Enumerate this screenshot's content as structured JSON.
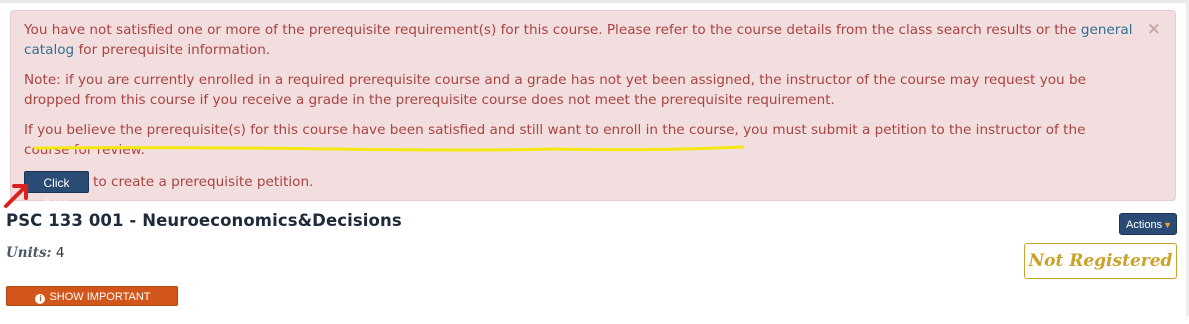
{
  "alert": {
    "p1_before": "You have not satisfied one or more of the prerequisite requirement(s) for this course. Please refer to the course details from the class search results or the ",
    "p1_link": "general catalog",
    "p1_after": " for prerequisite information.",
    "p2": "Note: if you are currently enrolled in a required prerequisite course and a grade has not yet been assigned, the instructor of the course may request you be dropped from this course if you receive a grade in the prerequisite course does not meet the prerequisite requirement.",
    "p3": "If you believe the prerequisite(s) for this course have been satisfied and still want to enroll in the course, you must submit a petition to the instructor of the course for review.",
    "close_symbol": "×",
    "button_label": "Click here",
    "button_suffix": "to create a prerequisite petition."
  },
  "course": {
    "title": "PSC 133 001 - Neuroeconomics&Decisions",
    "units_label": "Units:",
    "units_value": "4",
    "actions_label": "Actions",
    "status": "Not Registered",
    "details_button": "SHOW IMPORTANT DETAILS"
  },
  "colors": {
    "alert_bg": "#f2dede",
    "alert_text": "#a94442",
    "link": "#31708f",
    "primary_button": "#2a4b74",
    "status_gold": "#c9a227",
    "details_orange": "#d2561b",
    "annotation_yellow": "#f5e614",
    "annotation_red": "#d9221e"
  },
  "icons": [
    "close-icon",
    "caret-down-icon",
    "info-icon",
    "annotation-arrow-icon"
  ]
}
